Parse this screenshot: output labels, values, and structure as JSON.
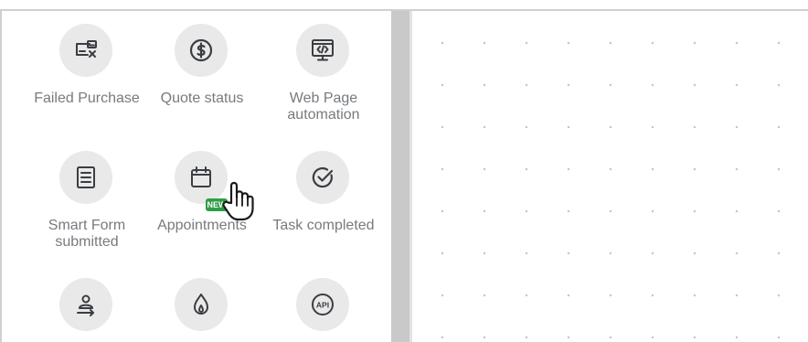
{
  "triggers": [
    {
      "label": "Failed Purchase",
      "icon": "failed-purchase-icon"
    },
    {
      "label": "Quote status",
      "icon": "dollar-icon"
    },
    {
      "label": "Web Page automation",
      "icon": "web-code-icon"
    },
    {
      "label": "Smart Form submitted",
      "icon": "form-icon"
    },
    {
      "label": "Appointments",
      "icon": "calendar-icon",
      "badge": "NEW"
    },
    {
      "label": "Task completed",
      "icon": "check-icon"
    },
    {
      "label": "",
      "icon": "person-arrow-icon"
    },
    {
      "label": "",
      "icon": "flame-icon"
    },
    {
      "label": "",
      "icon": "api-icon",
      "icon_text": "API"
    }
  ],
  "colors": {
    "icon_bg": "#e9e9e9",
    "icon_stroke": "#3a3d42",
    "label": "#777a7f",
    "badge": "#2e9e44",
    "splitter": "#c9c9c9",
    "canvas_dot": "#c4c4c4"
  },
  "cursor": "hand-pointer-icon"
}
